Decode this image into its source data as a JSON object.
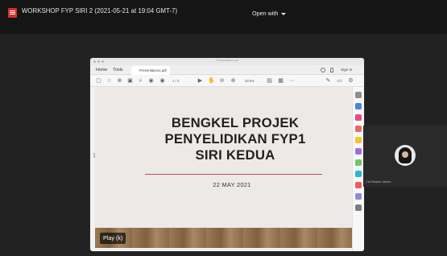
{
  "header": {
    "file_title": "WORKSHOP FYP SIRI 2 (2021-05-21 at 19:04 GMT-7)",
    "open_with_label": "Open with"
  },
  "viewer": {
    "window_title": "Presentation1.pdf",
    "tabs": [
      {
        "label": "Home"
      },
      {
        "label": "Tools"
      },
      {
        "label": "Presentation1.pdf"
      }
    ],
    "sign_in_label": "Sign In",
    "page_counter": "1 / 4",
    "zoom_value": "48.9%"
  },
  "slide": {
    "title_lines": [
      "BENGKEL PROJEK",
      "PENYELIDIKAN FYP1",
      "SIRI KEDUA"
    ],
    "date": "22 MAY 2021"
  },
  "playback": {
    "label": "Play (k)"
  },
  "participant": {
    "name": "Cik Eleanie James"
  },
  "icons": [
    "file-icon",
    "chevron-down-icon",
    "help-icon",
    "bell-icon",
    "star-icon",
    "print-icon",
    "search-icon",
    "pointer-icon",
    "hand-icon",
    "zoom-out-icon",
    "zoom-in-icon",
    "avatar-icon"
  ],
  "colors": {
    "background": "#1f1f1f",
    "file_icon": "#d93025",
    "slide_rule": "#c9495a"
  }
}
